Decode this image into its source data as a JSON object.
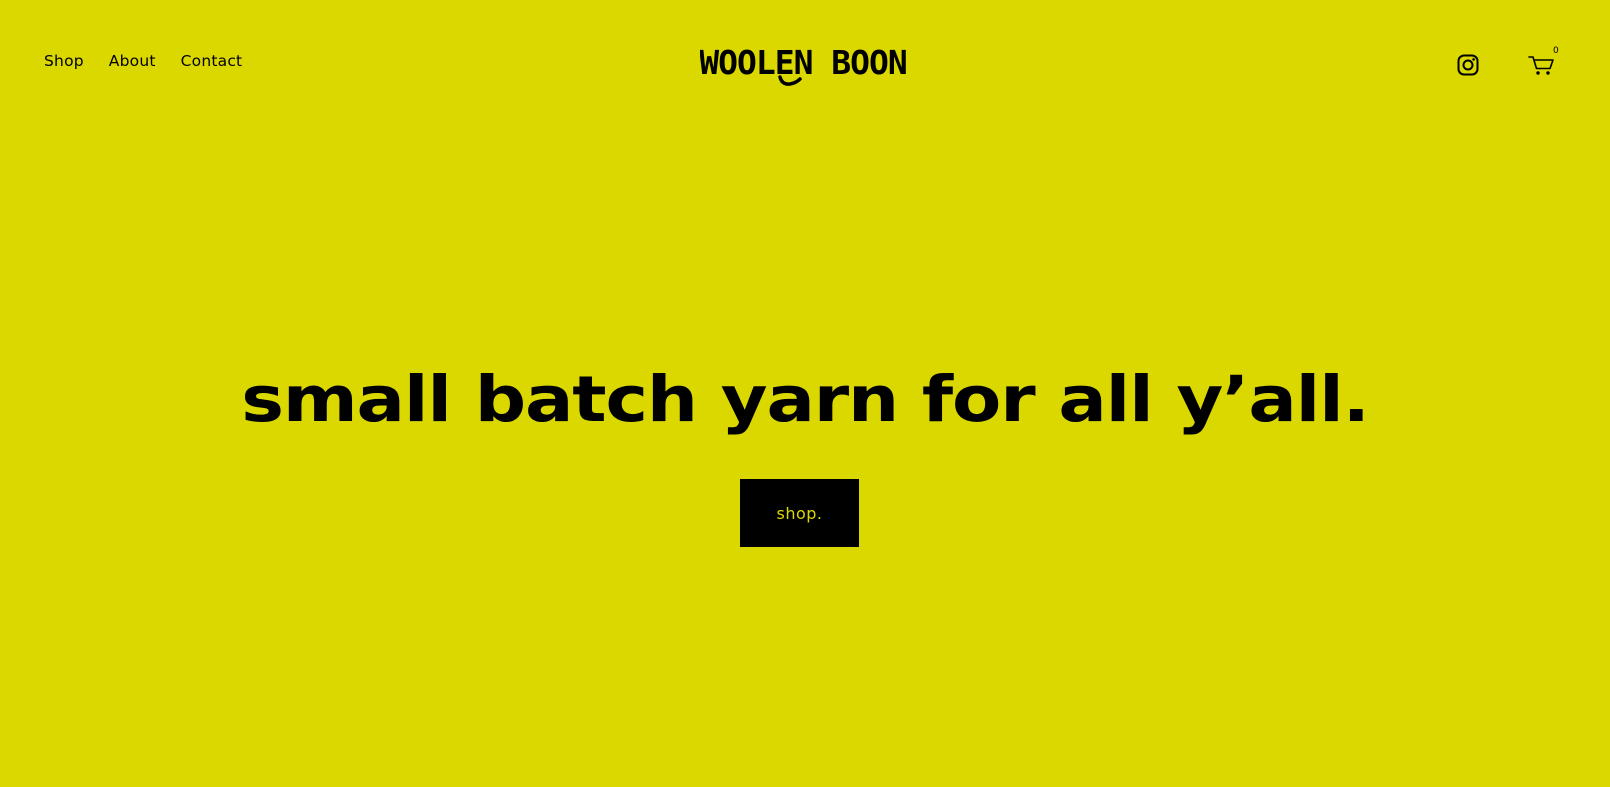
{
  "header": {
    "nav": {
      "shop_label": "Shop",
      "about_label": "About",
      "contact_label": "Contact"
    },
    "logo_text": "WOOLEN BOON",
    "social_icon": "instagram-icon",
    "cart_icon": "cart-icon",
    "cart_count": "0"
  },
  "hero": {
    "title": "small batch yarn for all y’all.",
    "button_label": "shop."
  },
  "colors": {
    "background": "#dbd800",
    "text": "#000000",
    "button_bg": "#000000",
    "button_text": "#dbd800"
  }
}
